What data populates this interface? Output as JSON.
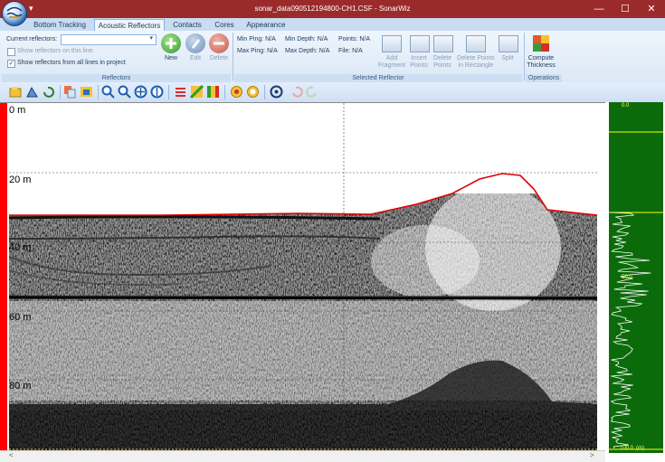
{
  "window": {
    "title": "sonar_data090512194800-CH1.CSF - SonarWiz",
    "minimize": "—",
    "maximize": "☐",
    "close": "✕",
    "qat": "▾"
  },
  "tabs": [
    {
      "label": "Bottom Tracking",
      "active": false
    },
    {
      "label": "Acoustic Reflectors",
      "active": true
    },
    {
      "label": "Contacts",
      "active": false
    },
    {
      "label": "Cores",
      "active": false
    },
    {
      "label": "Appearance",
      "active": false
    }
  ],
  "reflectors_group": {
    "current_label": "Current reflectors:",
    "combo_value": "",
    "show_on_line": "Show reflectors on this line.",
    "show_on_line_checked": false,
    "show_all": "Show reflectors from all lines in project",
    "show_all_checked": true,
    "new": "New",
    "edit": "Edit",
    "delete": "Delete",
    "group_label": "Reflectors"
  },
  "selected_group": {
    "min_ping": "Min Ping: N/A",
    "max_ping": "Max Ping: N/A",
    "min_depth": "Min Depth: N/A",
    "max_depth": "Max Depth: N/A",
    "points": "Points: N/A",
    "file": "File: N/A",
    "add_fragment": [
      "Add",
      "Fragment"
    ],
    "insert_points": [
      "Insert",
      "Points"
    ],
    "delete_points": [
      "Delete",
      "Points"
    ],
    "delete_points_rect": [
      "Delete Points",
      "in Rectangle"
    ],
    "split": "Split",
    "group_label": "Selected Reflector"
  },
  "operations_group": {
    "compute": [
      "Compute",
      "Thickness"
    ],
    "group_label": "Operations"
  },
  "depth_labels": [
    "0 m",
    "20 m",
    "40 m",
    "60 m",
    "80 m"
  ],
  "side_panel": {
    "top_value": "0.0",
    "mid_value": "50.0",
    "bottom_value": "100.0",
    "unit": "(m)"
  },
  "scrollbar": {
    "left": "<",
    "right": ">"
  },
  "colors": {
    "titlebar": "#9b2a2a",
    "ribbon": "#dbe8f7",
    "side_green": "#0b6b0b",
    "ping_bar": "#ff0000"
  }
}
